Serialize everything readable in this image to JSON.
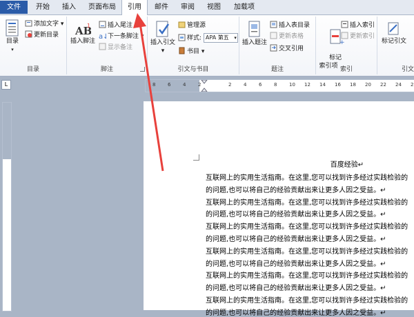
{
  "tabs": [
    "文件",
    "开始",
    "插入",
    "页面布局",
    "引用",
    "邮件",
    "审阅",
    "视图",
    "加载项"
  ],
  "groups": {
    "toc": {
      "label": "目录",
      "big": "目录",
      "add_text": "添加文字",
      "update": "更新目录"
    },
    "footnote": {
      "label": "脚注",
      "big": "插入脚注",
      "insert_end": "插入尾注",
      "next": "下一条脚注",
      "show": "显示备注"
    },
    "citation": {
      "label": "引文与书目",
      "big": "插入引文",
      "manage": "管理源",
      "style_label": "样式:",
      "style_value": "APA 第五",
      "biblio": "书目"
    },
    "caption": {
      "label": "题注",
      "big": "插入题注",
      "table_of_fig": "插入表目录",
      "update_table": "更新表格",
      "cross_ref": "交叉引用"
    },
    "index": {
      "label": "索引",
      "big": "标记\n索引项",
      "insert": "插入索引",
      "update": "更新索引"
    },
    "toa": {
      "label": "引文",
      "big": "标记引文"
    }
  },
  "ruler_ticks": [
    "8",
    "6",
    "4",
    "2",
    "",
    "2",
    "4",
    "6",
    "8",
    "10",
    "12",
    "14",
    "16",
    "18",
    "20",
    "22",
    "24",
    "26"
  ],
  "document": {
    "title": "百度经验↵",
    "lines": [
      "互联网上的实用生活指南。在这里,您可以找到许多经过实践检验的",
      "的问题,也可以将自己的经验贡献出来让更多人因之受益。↵",
      "互联网上的实用生活指南。在这里,您可以找到许多经过实践检验的",
      "的问题,也可以将自己的经验贡献出来让更多人因之受益。↵",
      "互联网上的实用生活指南。在这里,您可以找到许多经过实践检验的",
      "的问题,也可以将自己的经验贡献出来让更多人因之受益。↵",
      "互联网上的实用生活指南。在这里,您可以找到许多经过实践检验的",
      "的问题,也可以将自己的经验贡献出来让更多人因之受益。↵",
      "互联网上的实用生活指南。在这里,您可以找到许多经过实践检验的",
      "的问题,也可以将自己的经验贡献出来让更多人因之受益。↵",
      "互联网上的实用生活指南。在这里,您可以找到许多经过实践检验的",
      "的问题,也可以将自己的经验贡献出来让更多人因之受益。↵"
    ]
  },
  "colors": {
    "file_tab": "#2a5ba8",
    "arrow": "#e8413c",
    "workspace": "#a9b5c6"
  }
}
